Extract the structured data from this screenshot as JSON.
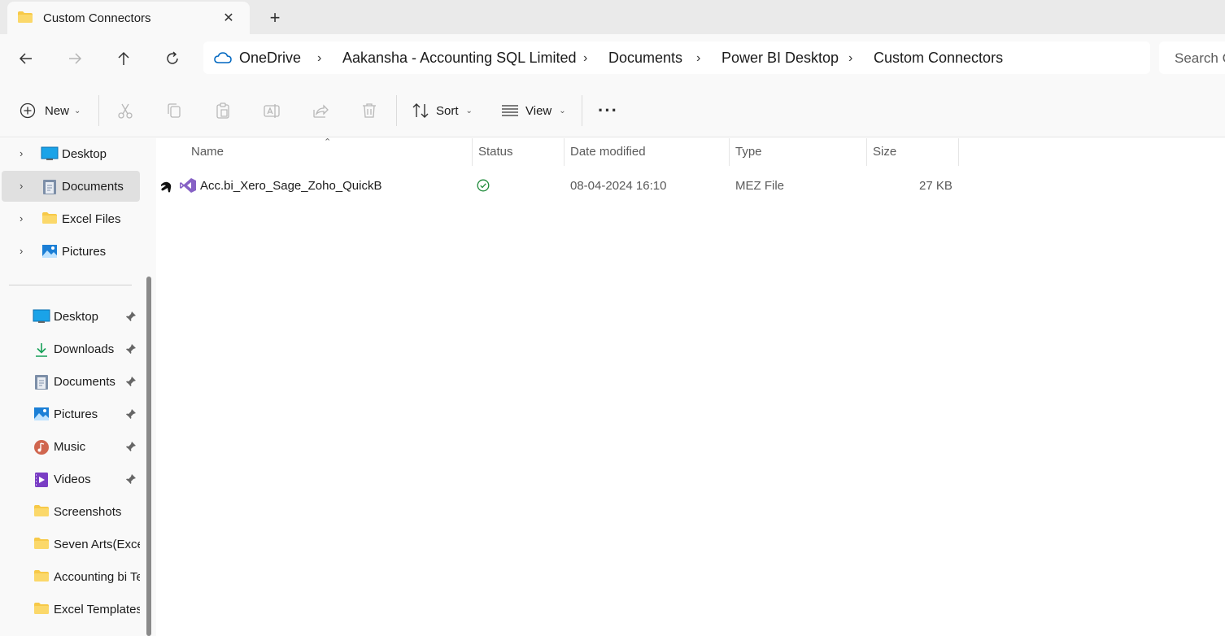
{
  "tab": {
    "title": "Custom Connectors"
  },
  "address": {
    "crumbs": [
      "OneDrive",
      "Aakansha - Accounting SQL Limited",
      "Documents",
      "Power BI Desktop",
      "Custom Connectors"
    ]
  },
  "search": {
    "placeholder": "Search C"
  },
  "toolbar": {
    "new_label": "New",
    "sort_label": "Sort",
    "view_label": "View",
    "more_label": "···"
  },
  "tree": [
    {
      "label": "Desktop"
    },
    {
      "label": "Documents"
    },
    {
      "label": "Excel Files"
    },
    {
      "label": "Pictures"
    }
  ],
  "quick_access": [
    {
      "label": "Desktop"
    },
    {
      "label": "Downloads"
    },
    {
      "label": "Documents"
    },
    {
      "label": "Pictures"
    },
    {
      "label": "Music"
    },
    {
      "label": "Videos"
    },
    {
      "label": "Screenshots"
    },
    {
      "label": "Seven Arts(Excel"
    },
    {
      "label": "Accounting bi Te"
    },
    {
      "label": "Excel Templates"
    }
  ],
  "columns": {
    "name": "Name",
    "status": "Status",
    "date": "Date modified",
    "type": "Type",
    "size": "Size"
  },
  "files": [
    {
      "name": "Acc.bi_Xero_Sage_Zoho_QuickB",
      "date": "08-04-2024 16:10",
      "type": "MEZ File",
      "size": "27 KB"
    }
  ],
  "colors": {
    "folder": "#f7c948",
    "accent": "#0067c0",
    "status_ok": "#1e8a3a",
    "vs_purple": "#7b4fbf"
  }
}
